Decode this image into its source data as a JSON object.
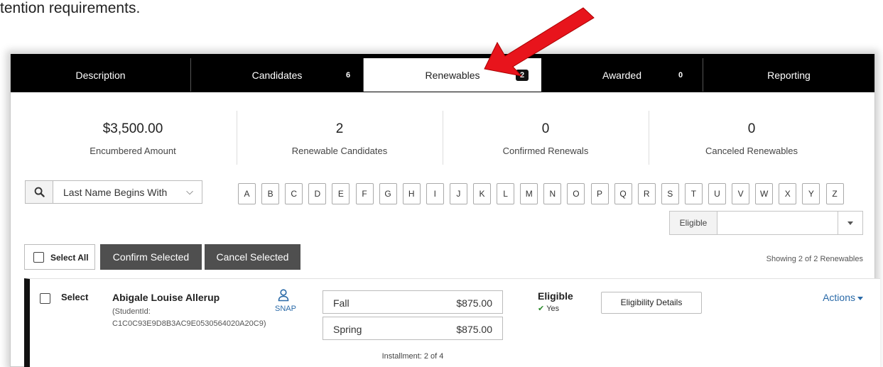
{
  "doc": {
    "text": "tention requirements."
  },
  "tabs": [
    {
      "label": "Description",
      "count": ""
    },
    {
      "label": "Candidates",
      "count": "6"
    },
    {
      "label": "Renewables",
      "count": "2"
    },
    {
      "label": "Awarded",
      "count": "0"
    },
    {
      "label": "Reporting",
      "count": ""
    }
  ],
  "stats": [
    {
      "value": "$3,500.00",
      "label": "Encumbered Amount"
    },
    {
      "value": "2",
      "label": "Renewable Candidates"
    },
    {
      "value": "0",
      "label": "Confirmed Renewals"
    },
    {
      "value": "0",
      "label": "Canceled Renewables"
    }
  ],
  "filter": {
    "name_select": "Last Name Begins With",
    "icon": "search-icon"
  },
  "letters": [
    "A",
    "B",
    "C",
    "D",
    "E",
    "F",
    "G",
    "H",
    "I",
    "J",
    "K",
    "L",
    "M",
    "N",
    "O",
    "P",
    "Q",
    "R",
    "S",
    "T",
    "U",
    "V",
    "W",
    "X",
    "Y",
    "Z"
  ],
  "eligible_filter": {
    "label": "Eligible",
    "value": ""
  },
  "toolbar": {
    "select_all": "Select All",
    "confirm": "Confirm Selected",
    "cancel": "Cancel Selected",
    "showing": "Showing 2 of 2 Renewables"
  },
  "row": {
    "select": "Select",
    "name": "Abigale Louise Allerup",
    "student_id_line1": "(StudentId:",
    "student_id_line2": "C1C0C93E9D8B3AC9E0530564020A20C9)",
    "snap": "SNAP",
    "installments": [
      {
        "term": "Fall",
        "amount": "$875.00"
      },
      {
        "term": "Spring",
        "amount": "$875.00"
      }
    ],
    "installment_text": "Installment: 2 of 4",
    "eligible_label": "Eligible",
    "eligible_value": "Yes",
    "details_button": "Eligibility Details",
    "actions": "Actions"
  },
  "colors": {
    "tab_bg": "#000000",
    "dark_button": "#4f4f4f",
    "link": "#2a6aa8",
    "arrow": "#e8141c"
  }
}
